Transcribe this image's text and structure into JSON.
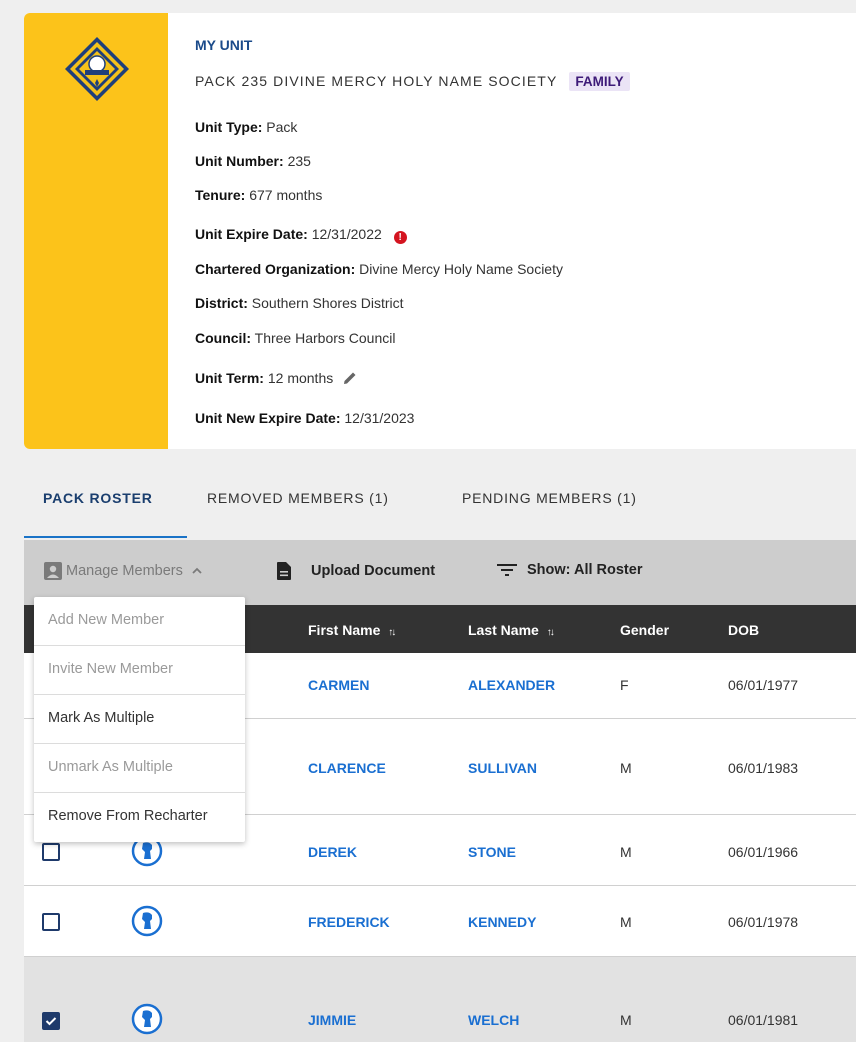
{
  "unit": {
    "section_title": "MY UNIT",
    "name": "PACK 235 DIVINE MERCY HOLY NAME SOCIETY",
    "badge": "FAMILY",
    "details": [
      {
        "label": "Unit Type:",
        "value": "Pack"
      },
      {
        "label": "Unit Number:",
        "value": "235"
      },
      {
        "label": "Tenure:",
        "value": "677 months"
      },
      {
        "label": "Unit Expire Date:",
        "value": "12/31/2022"
      },
      {
        "label": "Chartered Organization:",
        "value": "Divine Mercy Holy Name Society"
      },
      {
        "label": "District:",
        "value": "Southern Shores District"
      },
      {
        "label": "Council:",
        "value": "Three Harbors Council"
      },
      {
        "label": "Unit Term:",
        "value": "12 months"
      },
      {
        "label": "Unit New Expire Date:",
        "value": "12/31/2023"
      }
    ],
    "expire_alert_icon": "!"
  },
  "tabs": [
    {
      "label": "PACK ROSTER"
    },
    {
      "label": "REMOVED MEMBERS (1)"
    },
    {
      "label": "PENDING MEMBERS (1)"
    }
  ],
  "toolbar": {
    "manage": "Manage Members",
    "upload": "Upload Document",
    "show": "Show: All Roster"
  },
  "menu": [
    {
      "label": "Add New Member",
      "enabled": false
    },
    {
      "label": "Invite New Member",
      "enabled": false
    },
    {
      "label": "Mark As Multiple",
      "enabled": true
    },
    {
      "label": "Unmark As Multiple",
      "enabled": false
    },
    {
      "label": "Remove From Recharter",
      "enabled": true
    }
  ],
  "table": {
    "headers": {
      "first": "First Name",
      "last": "Last Name",
      "gender": "Gender",
      "dob": "DOB",
      "sort_icon": "↑↓"
    },
    "rows": [
      {
        "first": "CARMEN",
        "last": "ALEXANDER",
        "gender": "F",
        "dob": "06/01/1977",
        "selected": false
      },
      {
        "first": "CLARENCE",
        "last": "SULLIVAN",
        "gender": "M",
        "dob": "06/01/1983",
        "selected": false
      },
      {
        "first": "DEREK",
        "last": "STONE",
        "gender": "M",
        "dob": "06/01/1966",
        "selected": false
      },
      {
        "first": "FREDERICK",
        "last": "KENNEDY",
        "gender": "M",
        "dob": "06/01/1978",
        "selected": false
      },
      {
        "first": "JIMMIE",
        "last": "WELCH",
        "gender": "M",
        "dob": "06/01/1981",
        "selected": true
      }
    ]
  },
  "colors": {
    "accent_yellow": "#fcc31a",
    "link_blue": "#1a6fd1",
    "badge_bg": "#ebe4f6",
    "alert_red": "#d41420"
  }
}
